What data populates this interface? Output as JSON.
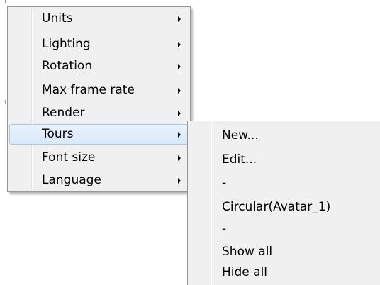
{
  "menu": {
    "items": [
      {
        "label": "Units",
        "has_submenu": true
      },
      {
        "label": "Lighting",
        "has_submenu": true
      },
      {
        "label": "Rotation",
        "has_submenu": true
      },
      {
        "label": "Max frame rate",
        "has_submenu": true
      },
      {
        "label": "Render",
        "has_submenu": true
      },
      {
        "label": "Tours",
        "has_submenu": true,
        "highlighted": true
      },
      {
        "label": "Font size",
        "has_submenu": true
      },
      {
        "label": "Language",
        "has_submenu": true
      }
    ]
  },
  "submenu": {
    "items": [
      {
        "label": "New..."
      },
      {
        "label": "Edit..."
      },
      {
        "label": "-"
      },
      {
        "label": "Circular(Avatar_1)"
      },
      {
        "label": "-"
      },
      {
        "label": "Show all"
      },
      {
        "label": "Hide all"
      }
    ]
  },
  "colors": {
    "menu_background": "#f0f0f0",
    "menu_border": "#979797",
    "highlight_background": "#d9e8fa",
    "highlight_border": "#a9c6ea"
  }
}
